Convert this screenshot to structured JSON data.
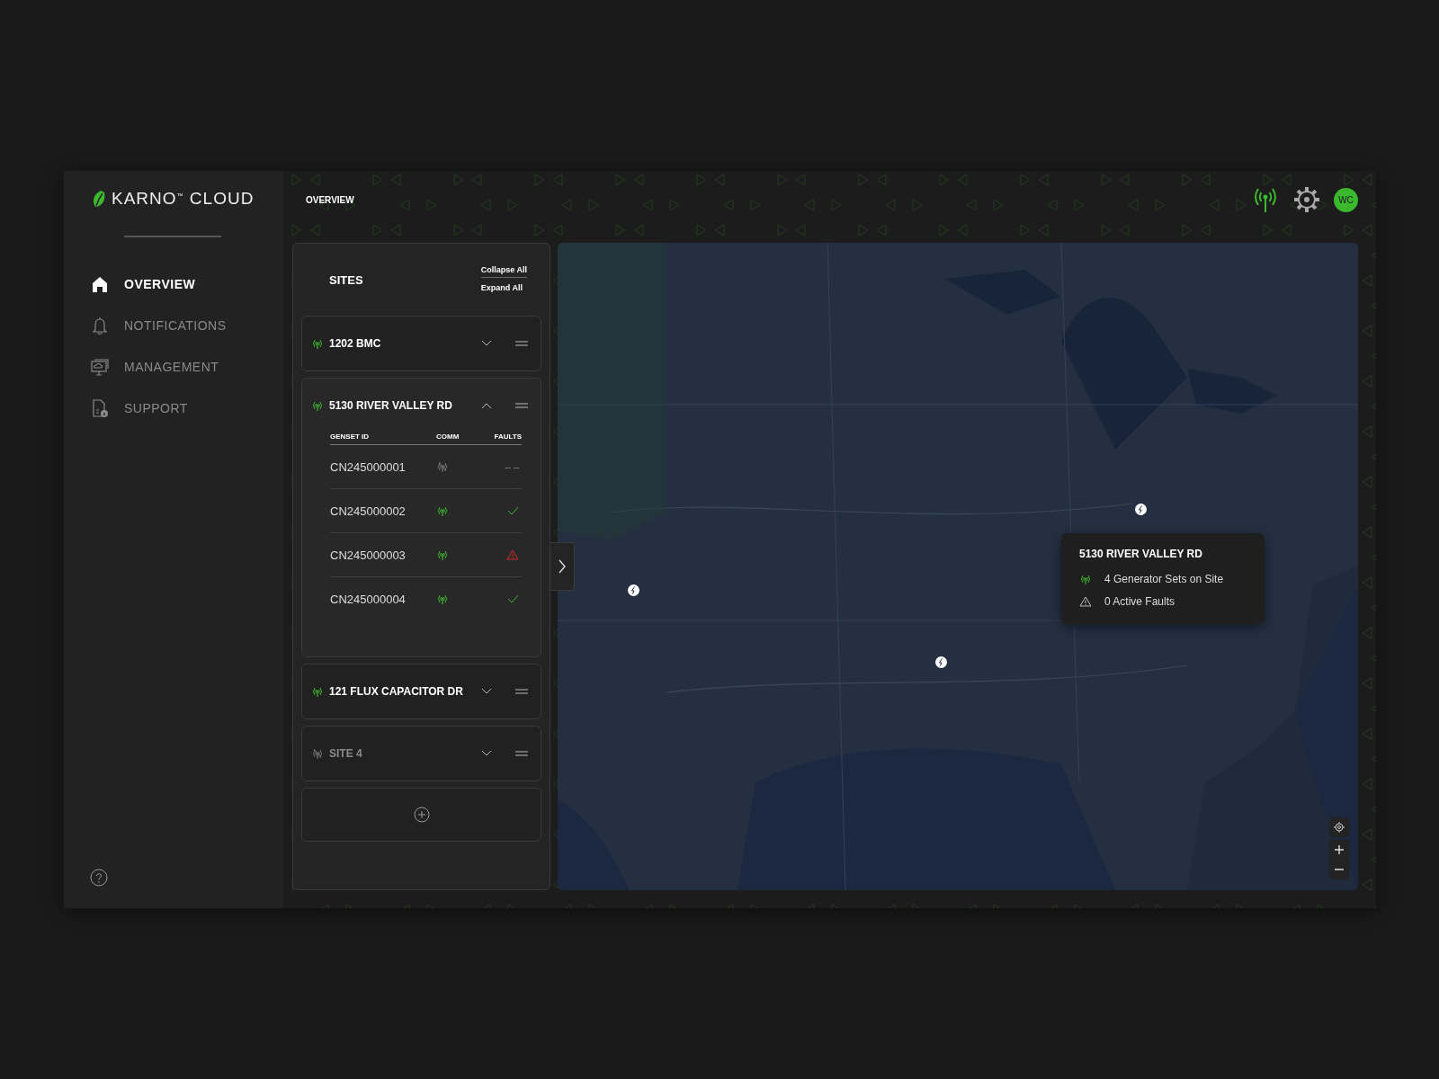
{
  "logo": "KARNO$^{™}$ CLOUD",
  "nav": [
    {
      "label": "OVERVIEW",
      "selected": true
    },
    {
      "label": "NOTIFICATIONS",
      "selected": false
    },
    {
      "label": "MANAGEMENT",
      "selected": false
    },
    {
      "label": "SUPPORT",
      "selected": false
    }
  ],
  "header": {
    "breadcrumb": "OVERVIEW",
    "connection_online": true,
    "avatar": "WC"
  },
  "sites_panel": {
    "title": "SITES",
    "actions": [
      "Collapse All",
      "Expand All"
    ],
    "columns": [
      "GENSET ID",
      "COMM",
      "FAULTS"
    ],
    "sites": [
      {
        "name": "1202 BMC",
        "online": true,
        "expanded": false
      },
      {
        "name": "5130 RIVER VALLEY RD",
        "online": true,
        "expanded": true,
        "gensets": [
          {
            "id": "CN245000001",
            "online": false,
            "kind": "unknown",
            "faults": "– –"
          },
          {
            "id": "CN245000002",
            "online": true,
            "kind": "ok"
          },
          {
            "id": "CN245000003",
            "online": true,
            "kind": "active"
          },
          {
            "id": "CN245000004",
            "online": true,
            "kind": "ok"
          }
        ]
      },
      {
        "name": "121 FLUX CAPACITOR DR",
        "online": true,
        "expanded": false
      },
      {
        "name": "SITE 4",
        "online": false,
        "expanded": false
      }
    ]
  },
  "map": {
    "kind": "picture",
    "tooltip": {
      "title": "5130 RIVER VALLEY RD",
      "items": [
        {
          "kind": "comm",
          "text": "4 Generator Sets on Site"
        },
        {
          "kind": "faults",
          "text": "0 Active Faults"
        }
      ]
    }
  }
}
